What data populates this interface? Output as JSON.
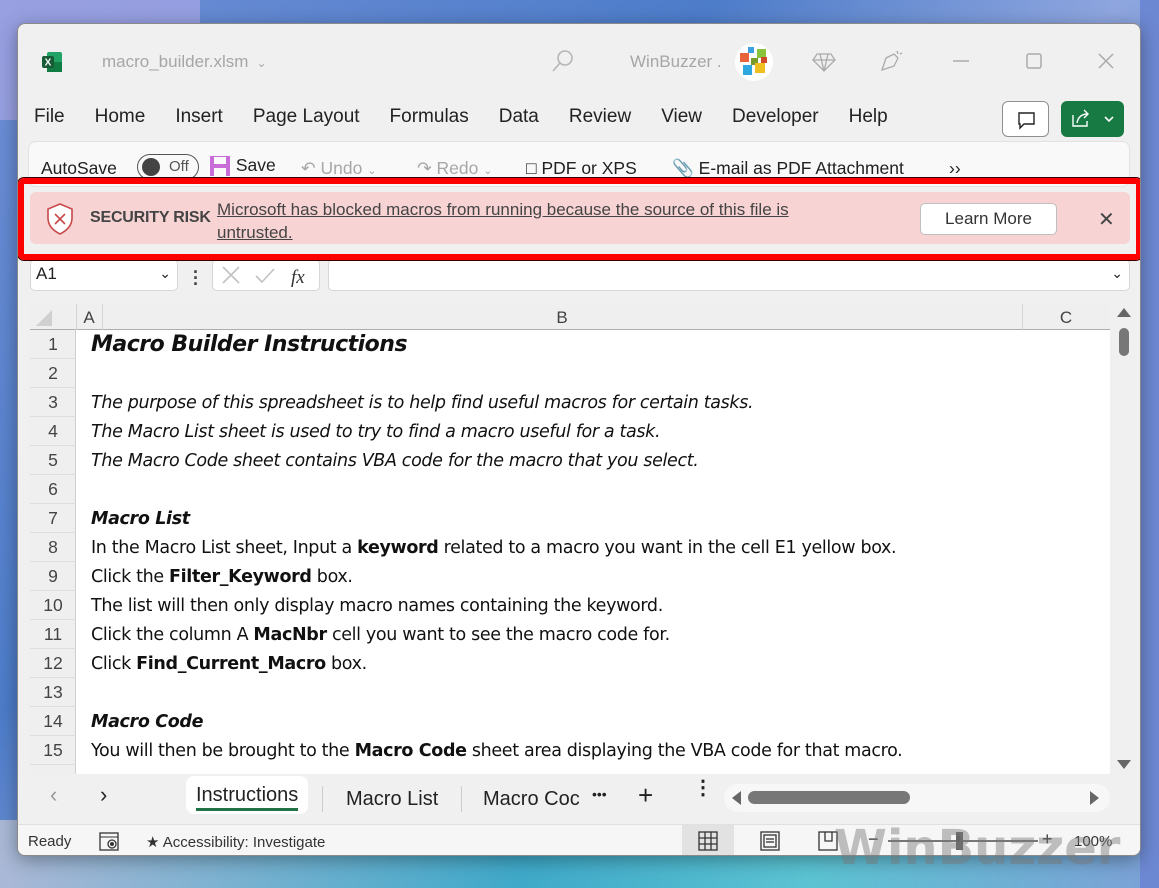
{
  "titlebar": {
    "filename": "macro_builder.xlsm",
    "account": "WinBuzzer .",
    "icons": [
      "excel-logo-icon",
      "search-icon",
      "avatar",
      "diamond-premium-icon",
      "pen-tip-icon",
      "minimize-icon",
      "maximize-icon",
      "close-icon"
    ]
  },
  "ribbon": {
    "tabs": [
      "File",
      "Home",
      "Insert",
      "Page Layout",
      "Formulas",
      "Data",
      "Review",
      "View",
      "Developer",
      "Help"
    ],
    "active_tab": "Home"
  },
  "qat": {
    "autosave_label": "AutoSave",
    "autosave_state": "Off",
    "save": "Save",
    "undo": "Undo",
    "redo": "Redo",
    "pdf": "PDF or XPS",
    "email_pdf": "E-mail as PDF Attachment",
    "more": "››"
  },
  "security_bar": {
    "title": "SECURITY RISK",
    "message": "Microsoft has blocked macros from running because the source of this file is untrusted.",
    "learn_more": "Learn More",
    "close": "✕",
    "highlight_color": "#ff0000",
    "bg_color": "#f7d3d3"
  },
  "formula_bar": {
    "name_box": "A1",
    "fx": "fx",
    "formula": ""
  },
  "grid": {
    "columns": [
      "A",
      "B",
      "C"
    ],
    "rows": [
      {
        "n": "1",
        "style": "title",
        "html": "Macro Builder Instructions"
      },
      {
        "n": "2",
        "style": "",
        "html": ""
      },
      {
        "n": "3",
        "style": "it",
        "html": "The purpose of this spreadsheet is to help find useful macros for certain tasks."
      },
      {
        "n": "4",
        "style": "it",
        "html": "The Macro List sheet is used to try to find a macro useful for a task."
      },
      {
        "n": "5",
        "style": "it",
        "html": "The Macro Code sheet contains VBA code for the macro that you select."
      },
      {
        "n": "6",
        "style": "",
        "html": ""
      },
      {
        "n": "7",
        "style": "hd",
        "html": "Macro List"
      },
      {
        "n": "8",
        "style": "",
        "html": "In the Macro List sheet, Input a <b>keyword</b> related to a macro you want in the cell E1 yellow box."
      },
      {
        "n": "9",
        "style": "",
        "html": "Click the <b>Filter_Keyword</b> box."
      },
      {
        "n": "10",
        "style": "",
        "html": "The list will then only display macro names containing the keyword."
      },
      {
        "n": "11",
        "style": "",
        "html": "Click the column A <b>MacNbr</b> cell you want to see the macro code for."
      },
      {
        "n": "12",
        "style": "",
        "html": "Click <b>Find_Current_Macro</b> box."
      },
      {
        "n": "13",
        "style": "",
        "html": ""
      },
      {
        "n": "14",
        "style": "hd",
        "html": "Macro Code"
      },
      {
        "n": "15",
        "style": "",
        "html": "You will then be brought to the <b>Macro Code</b> sheet area displaying the VBA code for that macro."
      }
    ]
  },
  "sheet_tabs": {
    "tabs": [
      "Instructions",
      "Macro List",
      "Macro Coc"
    ],
    "active": "Instructions",
    "more": "•••",
    "add": "+"
  },
  "statusbar": {
    "ready": "Ready",
    "accessibility": "Accessibility: Investigate",
    "zoom_level": "100%",
    "zoom_percent": 100
  },
  "watermark": "WinBuzzer"
}
